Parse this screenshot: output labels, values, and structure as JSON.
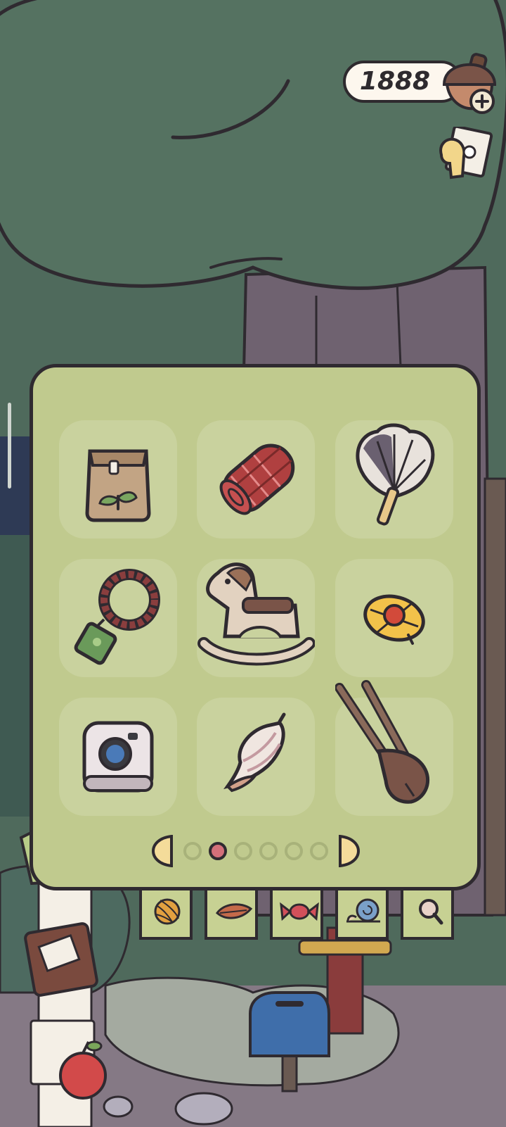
{
  "hud": {
    "currency_value": "1888",
    "currency_icon": "acorn-icon",
    "add_icon": "plus-icon",
    "journal_icon": "journal-icon"
  },
  "inventory": {
    "current_page": 2,
    "total_pages": 6,
    "items": [
      {
        "icon": "seed-packet-icon"
      },
      {
        "icon": "rolled-blanket-icon"
      },
      {
        "icon": "feather-fan-icon"
      },
      {
        "icon": "bead-bracelet-charm-icon"
      },
      {
        "icon": "rocking-horse-icon"
      },
      {
        "icon": "spinning-top-icon"
      },
      {
        "icon": "camera-icon"
      },
      {
        "icon": "seashell-icon"
      },
      {
        "icon": "wooden-chopsticks-icon"
      }
    ]
  },
  "category_tabs": [
    {
      "icon": "yarn-ball-icon"
    },
    {
      "icon": "leaf-icon"
    },
    {
      "icon": "candy-icon"
    },
    {
      "icon": "snail-icon"
    },
    {
      "icon": "magnifier-icon"
    }
  ],
  "colors": {
    "panel": "#c0ca8e",
    "slot": "#c9d29e",
    "outline": "#2f2a30",
    "tree": "#547060",
    "active_dot": "#d4707a"
  }
}
